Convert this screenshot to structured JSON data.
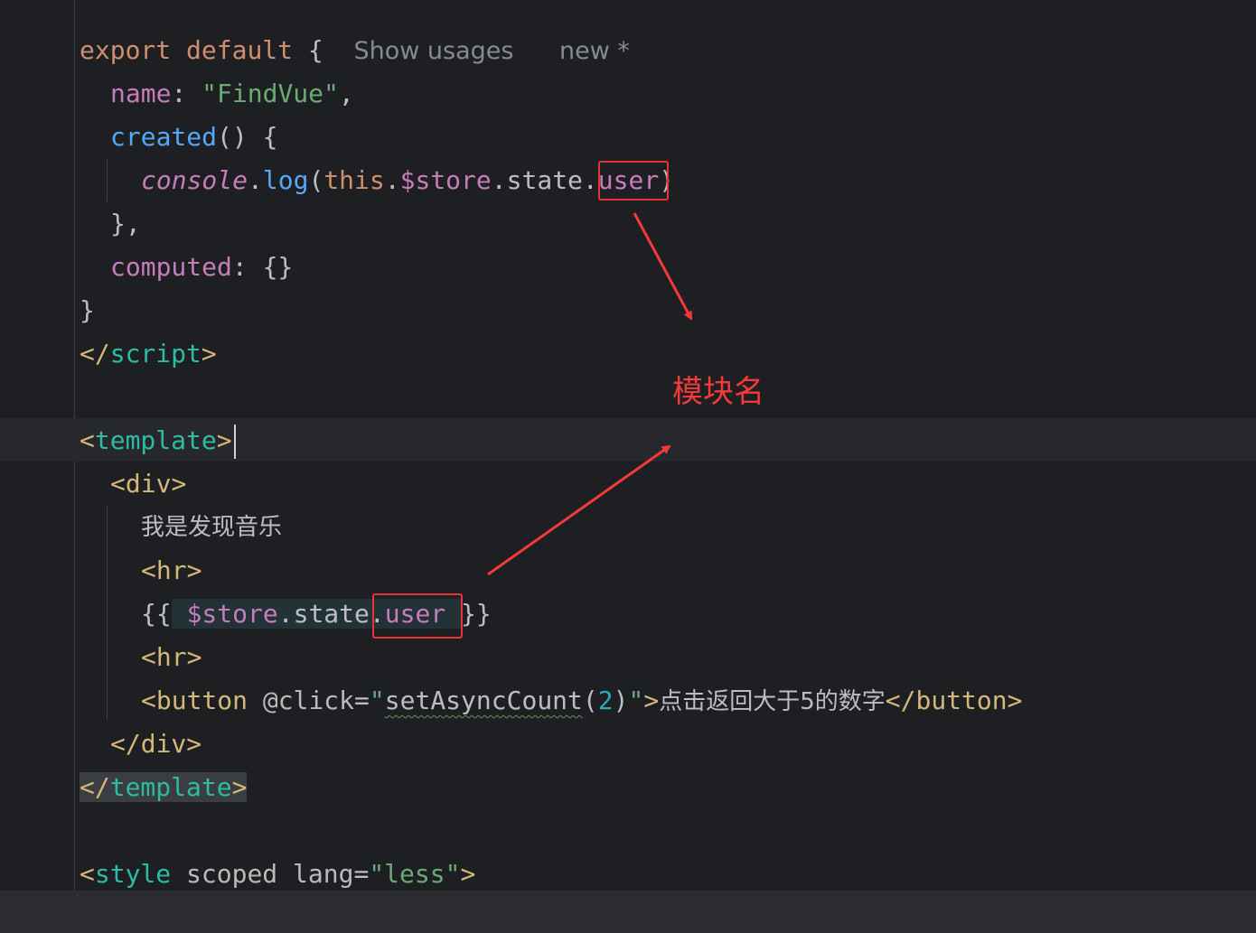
{
  "editor": {
    "lines": {
      "l1": {
        "kw1": "export",
        "kw2": "default",
        "brace": "{",
        "hint_usages": "Show usages",
        "hint_new": "new *"
      },
      "l2": {
        "key": "name",
        "colon": ":",
        "value": "\"FindVue\"",
        "comma": ","
      },
      "l3": {
        "fn": "created",
        "rest": "() {"
      },
      "l4": {
        "obj": "console",
        "dot1": ".",
        "method": "log",
        "open": "(",
        "this": "this",
        "dot2": ".",
        "store": "$store",
        "dot3": ".",
        "state": "state",
        "dot4": ".",
        "module": "user",
        "close": ")"
      },
      "l5": {
        "text": "},"
      },
      "l6": {
        "key": "computed",
        "colon": ":",
        "value": "{}"
      },
      "l7": {
        "text": "}"
      },
      "l8": {
        "open": "</",
        "name": "script",
        "close": ">"
      },
      "l9": {
        "open": "<",
        "name": "template",
        "close": ">"
      },
      "l10": {
        "open": "<",
        "name": "div",
        "close": ">"
      },
      "l11": {
        "text": "我是发现音乐"
      },
      "l12": {
        "open": "<",
        "name": "hr",
        "close": ">"
      },
      "l13": {
        "open": "{{",
        "store": "$store",
        "dot1": ".",
        "state": "state",
        "dot2": ".",
        "module": "user",
        "close": "}}"
      },
      "l14": {
        "open": "<",
        "name": "hr",
        "close": ">"
      },
      "l15": {
        "open": "<",
        "name": "button",
        "attr": "@click",
        "eq": "=",
        "q1": "\"",
        "fn": "setAsyncCount",
        "paren1": "(",
        "num": "2",
        "paren2": ")",
        "q2": "\"",
        "gt": ">",
        "text": "点击返回大于5的数字",
        "end_open": "</",
        "end_name": "button",
        "end_close": ">"
      },
      "l16": {
        "open": "</",
        "name": "div",
        "close": ">"
      },
      "l17": {
        "open": "</",
        "name": "template",
        "close": ">"
      },
      "l18": {
        "open": "<",
        "name": "style",
        "attr1": "scoped",
        "attr2": "lang",
        "eq": "=",
        "value": "\"less\"",
        "close": ">"
      }
    }
  },
  "annotation": {
    "label": "模块名",
    "color": "#f23a3a"
  },
  "colors": {
    "background": "#1e1f22",
    "keyword": "#cf8e6d",
    "property": "#c77dbb",
    "string": "#6aab73",
    "function": "#56a8f5",
    "tag_bracket": "#d5b778",
    "tag_name": "#2fbaa3"
  }
}
